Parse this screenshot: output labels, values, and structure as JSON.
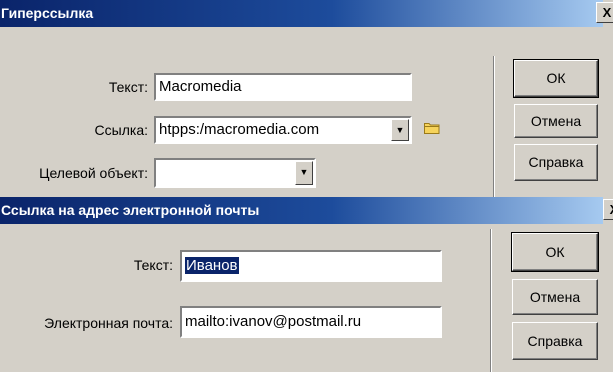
{
  "hyperlink_dialog": {
    "title": "Гиперссылка",
    "close_label": "X",
    "text_label": "Текст:",
    "text_value": "Macromedia",
    "link_label": "Ссылка:",
    "link_value": "htpps:/macromedia.com",
    "target_label": "Целевой объект:",
    "target_value": "",
    "ok_label": "ОК",
    "cancel_label": "Отмена",
    "help_label": "Справка"
  },
  "email_dialog": {
    "title": "Ссылка на адрес электронной почты",
    "close_label": "X",
    "text_label": "Текст:",
    "text_value": "Иванов",
    "email_label": "Электронная почта:",
    "email_value": "mailto:ivanov@postmail.ru",
    "ok_label": "ОК",
    "cancel_label": "Отмена",
    "help_label": "Справка"
  },
  "icons": [
    "close-icon",
    "dropdown-arrow-icon",
    "folder-icon"
  ],
  "colors": {
    "titlebar_start": "#0a246a",
    "titlebar_end": "#a6caf0",
    "dialog_bg": "#d4d0c8",
    "selection": "#0a246a"
  }
}
